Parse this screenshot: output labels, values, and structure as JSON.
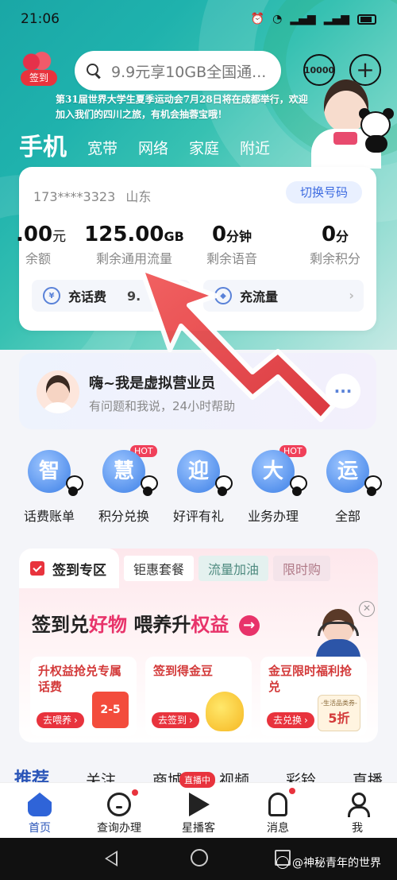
{
  "status_bar": {
    "time": "21:06",
    "icons": [
      "alarm-icon",
      "wifi-icon",
      "signal-icon",
      "signal-icon",
      "battery-icon"
    ]
  },
  "header": {
    "sign_in_label": "签到",
    "search_placeholder": "9.9元享10GB全国通...",
    "service_badge": "10000",
    "banner_text": "第31届世界大学生夏季运动会7月28日将在成都举行，欢迎加入我们的四川之旅，有机会抽蓉宝哦！",
    "tabs": [
      "手机",
      "宽带",
      "网络",
      "家庭",
      "附近"
    ]
  },
  "account": {
    "phone": "173****3323",
    "province": "山东",
    "switch_label": "切换号码",
    "stats": [
      {
        "value": ".00",
        "unit": "元",
        "label": "余额"
      },
      {
        "value": "125.00",
        "unit": "GB",
        "label": "剩余通用流量"
      },
      {
        "value": "0",
        "unit": "分钟",
        "label": "剩余语音"
      },
      {
        "value": "0",
        "unit": "分",
        "label": "剩余积分"
      }
    ],
    "recharge": [
      {
        "label": "充话费",
        "extra": "9."
      },
      {
        "label": "充流量",
        "extra": ""
      }
    ]
  },
  "assistant": {
    "title": "嗨~我是虚拟营业员",
    "subtitle": "有问题和我说，24小时帮助"
  },
  "services": [
    {
      "icon_char": "智",
      "label": "话费账单",
      "hot": ""
    },
    {
      "icon_char": "慧",
      "label": "积分兑换",
      "hot": "HOT"
    },
    {
      "icon_char": "迎",
      "label": "好评有礼",
      "hot": ""
    },
    {
      "icon_char": "大",
      "label": "业务办理",
      "hot": "HOT"
    },
    {
      "icon_char": "运",
      "label": "全部",
      "hot": ""
    }
  ],
  "sign_zone": {
    "tabs": [
      "签到专区",
      "钜惠套餐",
      "流量加油",
      "限时购"
    ],
    "headline_a": "签到兑",
    "headline_b": "好物",
    "headline_c": " 喂养升",
    "headline_d": "权益",
    "cards": [
      {
        "title": "升权益抢兑专属话费",
        "button": "去喂养",
        "deco": "2-5"
      },
      {
        "title": "签到得金豆",
        "button": "去签到",
        "deco": ""
      },
      {
        "title": "金豆限时福利抢兑",
        "button": "去兑换",
        "deco_top": "-生活品类券-",
        "deco": "5折"
      }
    ]
  },
  "feed_tabs": [
    "推荐",
    "关注",
    "商城",
    "视频",
    "彩铃",
    "直播"
  ],
  "bottom_nav": {
    "items": [
      {
        "label": "首页"
      },
      {
        "label": "查询办理"
      },
      {
        "label": "星播客"
      },
      {
        "label": "消息"
      },
      {
        "label": "我"
      }
    ],
    "live_badge": "直播中"
  },
  "watermark": "@神秘青年的世界",
  "colors": {
    "accent": "#2a55b8",
    "brand_red": "#e8333d",
    "hero_teal": "#1fb2ad",
    "arrow_red": "#e8444a"
  }
}
